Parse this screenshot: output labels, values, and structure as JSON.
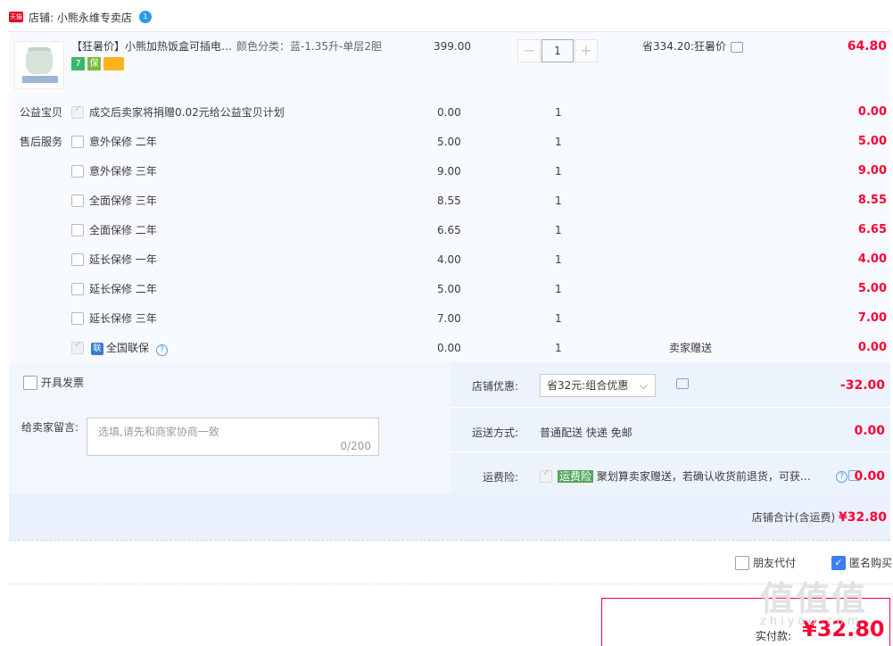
{
  "shop": {
    "logo_text": "天猫",
    "label": "店铺: 小熊永维专卖店",
    "ww_badge": "1"
  },
  "item": {
    "title": "【狂暑价】小熊加热饭盒可插电…",
    "sku": "颜色分类：蓝-1.35升-单层2胆",
    "unit_price": "399.00",
    "quantity": "1",
    "savings": "省334.20:狂暑价",
    "subtotal": "64.80",
    "minus": "−",
    "plus": "+",
    "badges": [
      "7",
      "保"
    ]
  },
  "services": {
    "charity_label": "公益宝贝",
    "aftersale_label": "售后服务",
    "rows": [
      {
        "text": "成交后卖家将捐赠0.02元给公益宝贝计划",
        "price": "0.00",
        "qty": "1",
        "note": "",
        "subtotal": "0.00"
      },
      {
        "text": "意外保修 二年",
        "price": "5.00",
        "qty": "1",
        "note": "",
        "subtotal": "5.00"
      },
      {
        "text": "意外保修 三年",
        "price": "9.00",
        "qty": "1",
        "note": "",
        "subtotal": "9.00"
      },
      {
        "text": "全面保修 三年",
        "price": "8.55",
        "qty": "1",
        "note": "",
        "subtotal": "8.55"
      },
      {
        "text": "全面保修 二年",
        "price": "6.65",
        "qty": "1",
        "note": "",
        "subtotal": "6.65"
      },
      {
        "text": "延长保修 一年",
        "price": "4.00",
        "qty": "1",
        "note": "",
        "subtotal": "4.00"
      },
      {
        "text": "延长保修 二年",
        "price": "5.00",
        "qty": "1",
        "note": "",
        "subtotal": "5.00"
      },
      {
        "text": "延长保修 三年",
        "price": "7.00",
        "qty": "1",
        "note": "",
        "subtotal": "7.00"
      },
      {
        "text": "全国联保",
        "price": "0.00",
        "qty": "1",
        "note": "卖家赠送",
        "subtotal": "0.00"
      }
    ],
    "lian_badge": "联",
    "help": "?"
  },
  "invoice": {
    "label": "开具发票"
  },
  "message": {
    "label": "给卖家留言:",
    "placeholder": "选填,请先和商家协商一致",
    "count": "0/200"
  },
  "shop_discount": {
    "label": "店铺优惠:",
    "selected": "省32元:组合优惠",
    "value": "-32.00"
  },
  "shipping": {
    "label": "运送方式:",
    "value": "普通配送 快递 免邮",
    "amount": "0.00"
  },
  "freight_ins": {
    "label": "运费险:",
    "tag": "运费险",
    "text": "聚划算卖家赠送，若确认收货前退货，可获…",
    "amount": "0.00"
  },
  "shop_total": {
    "label": "店铺合计(含运费)",
    "value": "¥32.80"
  },
  "options": {
    "friend_pay": "朋友代付",
    "anonymous": "匿名购买"
  },
  "payment": {
    "label": "实付款:",
    "amount": "¥32.80"
  },
  "watermark": {
    "main": "值值值",
    "sub": "zhiyou.com"
  },
  "colors": {
    "accent": "#ff0036",
    "checkbox": "#3d7ef2",
    "panel": "#f7faff"
  }
}
